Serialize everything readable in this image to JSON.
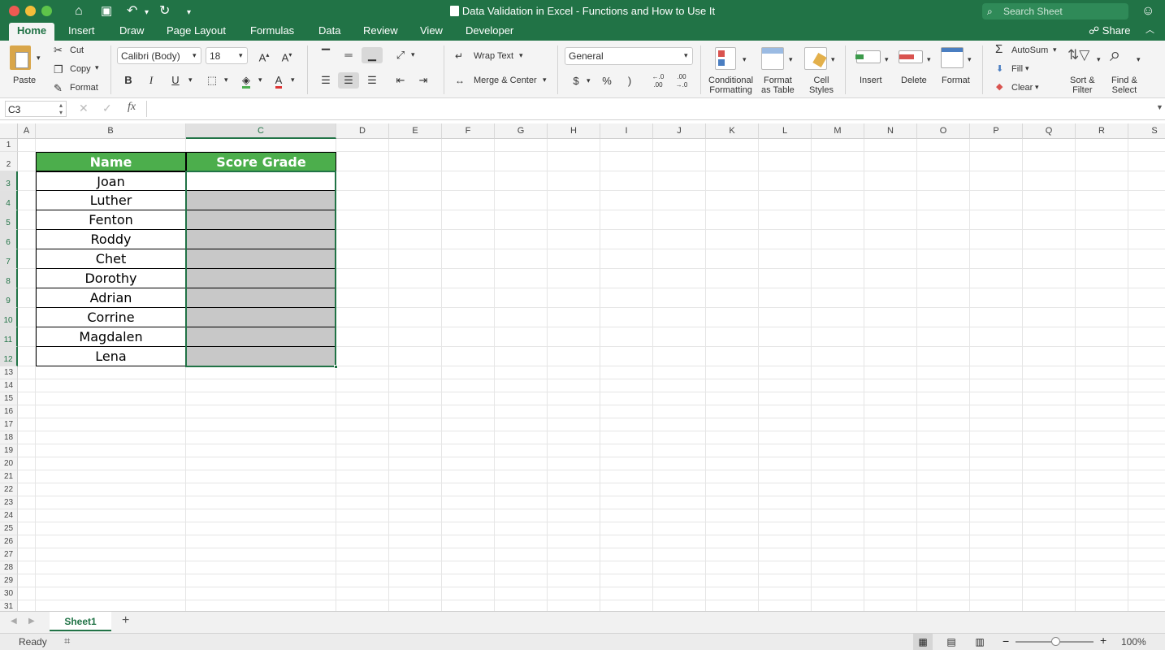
{
  "window": {
    "title": "Data Validation in Excel - Functions and How to Use It",
    "search_placeholder": "Search Sheet"
  },
  "tabs": [
    "Home",
    "Insert",
    "Draw",
    "Page Layout",
    "Formulas",
    "Data",
    "Review",
    "View",
    "Developer"
  ],
  "share_label": "Share",
  "ribbon": {
    "paste": "Paste",
    "cut": "Cut",
    "copy": "Copy",
    "format_painter": "Format",
    "font_name": "Calibri (Body)",
    "font_size": "18",
    "bold": "B",
    "italic": "I",
    "underline": "U",
    "wrap_text": "Wrap Text",
    "merge_center": "Merge & Center",
    "number_format": "General",
    "currency": "$",
    "percent": "%",
    "comma": ")",
    "cond_format_1": "Conditional",
    "cond_format_2": "Formatting",
    "format_table_1": "Format",
    "format_table_2": "as Table",
    "cell_styles_1": "Cell",
    "cell_styles_2": "Styles",
    "insert": "Insert",
    "delete": "Delete",
    "format": "Format",
    "autosum": "AutoSum",
    "fill": "Fill",
    "clear": "Clear",
    "sort_filter_1": "Sort &",
    "sort_filter_2": "Filter",
    "find_select_1": "Find &",
    "find_select_2": "Select"
  },
  "formula_bar": {
    "name_box": "C3",
    "fx": "fx",
    "formula": ""
  },
  "columns": [
    "A",
    "B",
    "C",
    "D",
    "E",
    "F",
    "G",
    "H",
    "I",
    "J",
    "K",
    "L",
    "M",
    "N",
    "O",
    "P",
    "Q",
    "R",
    "S"
  ],
  "rows": [
    "1",
    "2",
    "3",
    "4",
    "5",
    "6",
    "7",
    "8",
    "9",
    "10",
    "11",
    "12",
    "13",
    "14",
    "15",
    "16",
    "17",
    "18",
    "19",
    "20",
    "21",
    "22",
    "23",
    "24",
    "25",
    "26",
    "27",
    "28",
    "29",
    "30",
    "31"
  ],
  "table": {
    "headers": [
      "Name",
      "Score Grade"
    ],
    "names": [
      "Joan",
      "Luther",
      "Fenton",
      "Roddy",
      "Chet",
      "Dorothy",
      "Adrian",
      "Corrine",
      "Magdalen",
      "Lena"
    ],
    "header_color": "#4cae4c",
    "grade_fill_color": "#c8c8c8"
  },
  "sheet_tabs": [
    "Sheet1"
  ],
  "status": {
    "ready": "Ready",
    "zoom": "100%"
  },
  "colors": {
    "accent": "#217346"
  }
}
